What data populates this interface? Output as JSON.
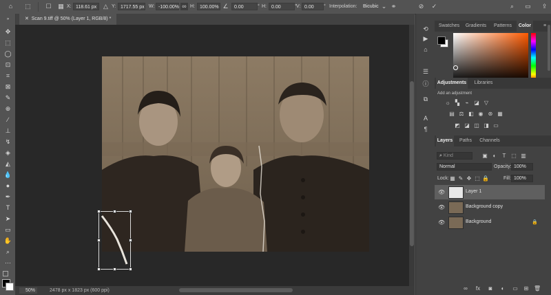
{
  "options_bar": {
    "x_label": "X:",
    "x_value": "118.61 px",
    "y_label": "Y:",
    "y_value": "1717.55 px",
    "w_label": "W:",
    "w_value": "-100.00%",
    "h_label": "H:",
    "h_value": "100.00%",
    "angle_value": "0.00",
    "hskew_label": "H:",
    "hskew_value": "0.00",
    "vskew_label": "V:",
    "vskew_value": "0.00",
    "interpolation_label": "Interpolation:",
    "interpolation_value": "Bicubic"
  },
  "document": {
    "tab_title": "Scan 9.tiff @ 50% (Layer 1, RGB/8) *"
  },
  "status_bar": {
    "zoom": "50%",
    "doc_info": "2478 px x 1823 px (600 ppi)"
  },
  "color_panel": {
    "tabs": [
      "Swatches",
      "Gradients",
      "Patterns",
      "Color"
    ],
    "active_tab": "Color",
    "foreground": "#000000",
    "background": "#ffffff"
  },
  "adjustments_panel": {
    "tabs": [
      "Adjustments",
      "Libraries"
    ],
    "hint": "Add an adjustment"
  },
  "layers_panel": {
    "tabs": [
      "Layers",
      "Paths",
      "Channels"
    ],
    "search_placeholder": "Kind",
    "blend_mode": "Normal",
    "opacity_label": "Opacity:",
    "opacity_value": "100%",
    "lock_label": "Lock:",
    "fill_label": "Fill:",
    "fill_value": "100%",
    "layers": [
      {
        "name": "Layer 1",
        "selected": true
      },
      {
        "name": "Background copy",
        "selected": false
      },
      {
        "name": "Background",
        "selected": false,
        "locked": true
      }
    ]
  },
  "colors": {
    "accent": "#ff5a00",
    "canvas_bg": "#282828",
    "panel_bg": "#424242"
  }
}
